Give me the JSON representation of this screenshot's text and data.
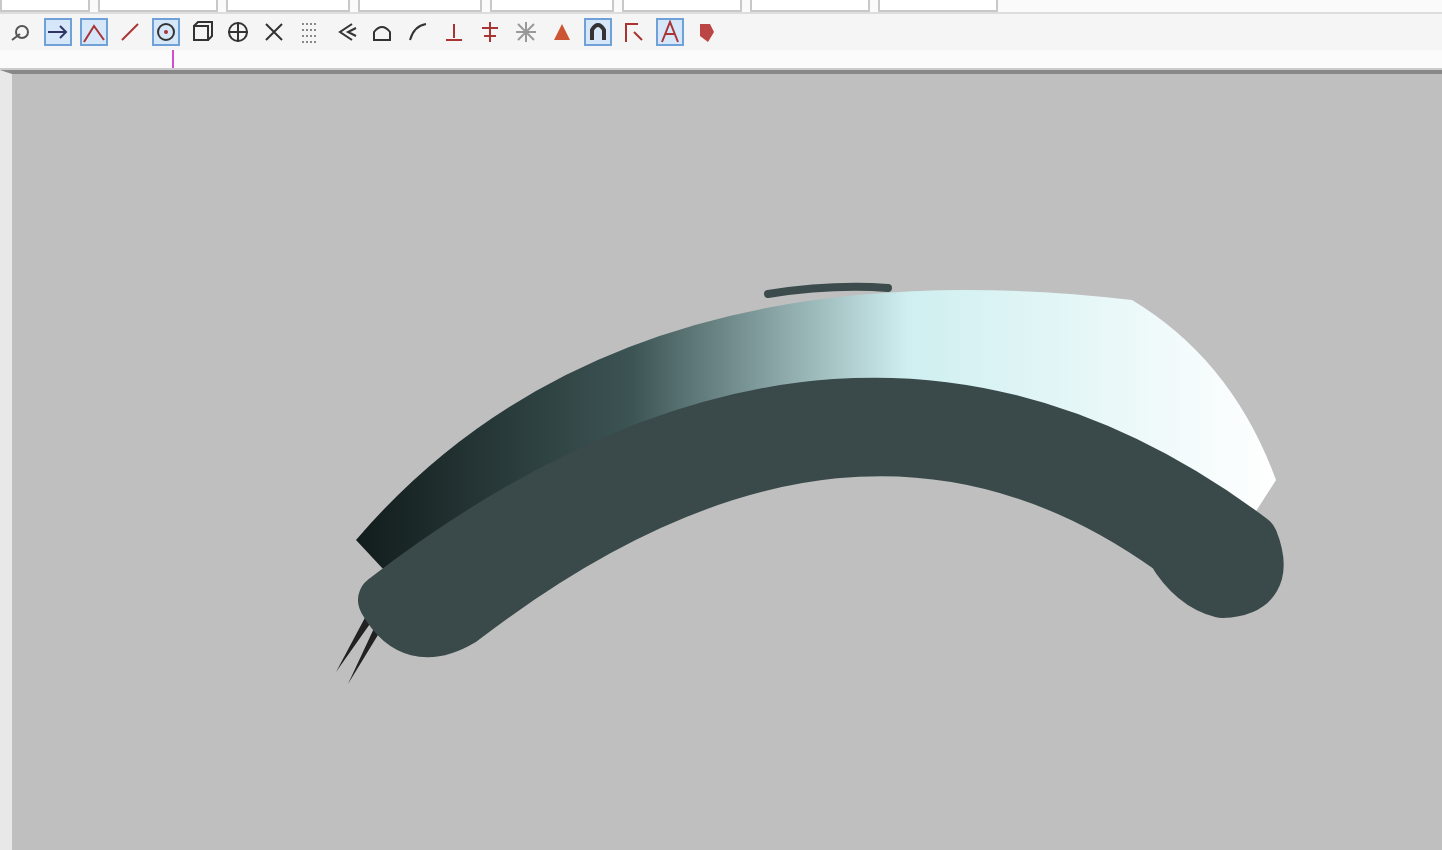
{
  "toolbar": {
    "tools": [
      {
        "kind": "snap",
        "selected": false
      },
      {
        "kind": "arrow",
        "selected": true
      },
      {
        "kind": "angle",
        "selected": true
      },
      {
        "kind": "line",
        "selected": false
      },
      {
        "kind": "circle",
        "selected": true
      },
      {
        "kind": "cube",
        "selected": false
      },
      {
        "kind": "crosshair",
        "selected": false
      },
      {
        "kind": "cross",
        "selected": false
      },
      {
        "kind": "grid",
        "selected": false
      },
      {
        "kind": "chevron",
        "selected": false
      },
      {
        "kind": "arch",
        "selected": false
      },
      {
        "kind": "curve",
        "selected": false
      },
      {
        "kind": "tee",
        "selected": false
      },
      {
        "kind": "teecross",
        "selected": false
      },
      {
        "kind": "star",
        "selected": false
      },
      {
        "kind": "flame",
        "selected": false
      },
      {
        "kind": "magnet",
        "selected": true
      },
      {
        "kind": "corner",
        "selected": false
      },
      {
        "kind": "letter",
        "selected": true
      },
      {
        "kind": "shape",
        "selected": false
      }
    ]
  }
}
